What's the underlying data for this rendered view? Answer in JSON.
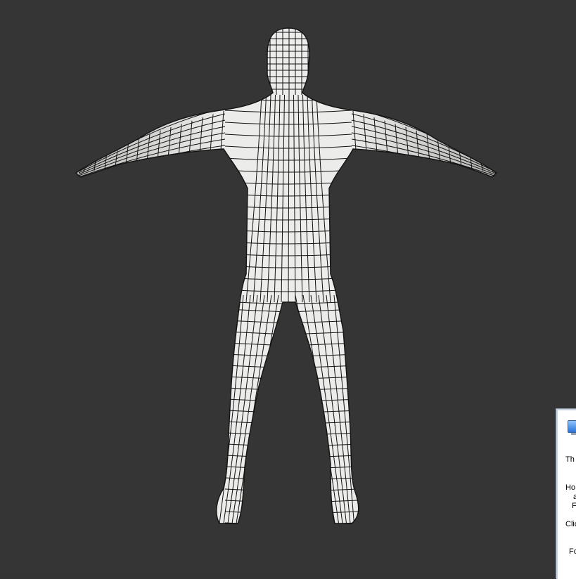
{
  "viewport": {
    "background": "#353535",
    "mesh_fill": "#e6e6e4",
    "wire_color": "#111111"
  },
  "popup": {
    "icon": "computer-icon",
    "line1": "Th",
    "line2": "Ho",
    "line3": "a",
    "line4": "F",
    "line5": "Clic",
    "line6": "Fo"
  }
}
